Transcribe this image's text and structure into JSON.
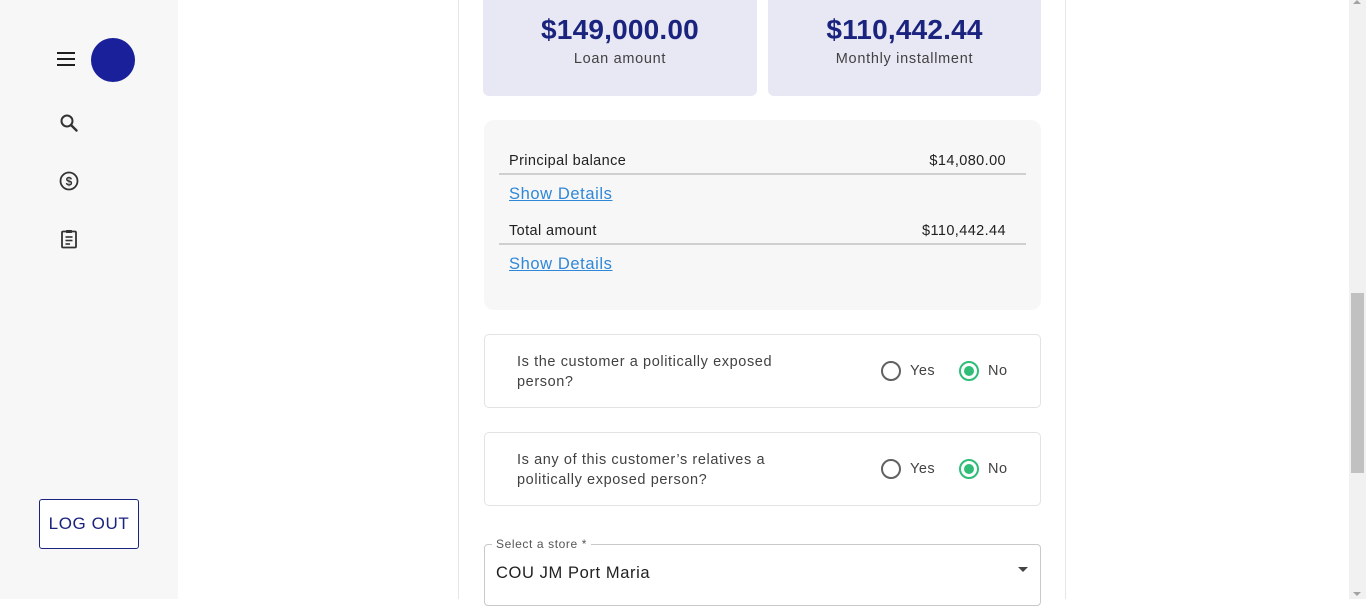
{
  "sidebar": {
    "logout_label": "LOG OUT",
    "icons": [
      "menu-icon",
      "search-icon",
      "dollar-icon",
      "clipboard-icon"
    ]
  },
  "stats": {
    "loan_amount_value": "$149,000.00",
    "loan_amount_label": "Loan amount",
    "monthly_installment_value": "$110,442.44",
    "monthly_installment_label": "Monthly installment"
  },
  "summary": {
    "principal_label": "Principal balance",
    "principal_value": "$14,080.00",
    "total_label": "Total amount",
    "total_value": "$110,442.44",
    "show_details_label": "Show Details"
  },
  "questions": [
    {
      "text": "Is the customer a politically exposed person?",
      "yes_label": "Yes",
      "no_label": "No",
      "selected": "No"
    },
    {
      "text": "Is any of this customer’s relatives a politically exposed person?",
      "yes_label": "Yes",
      "no_label": "No",
      "selected": "No"
    }
  ],
  "store_select": {
    "label": "Select a store *",
    "value": "COU JM Port Maria"
  },
  "colors": {
    "brand": "#1a237e",
    "avatar": "#1a1f9a",
    "stat_card_bg": "#e8e8f5",
    "link": "#2f87d8",
    "radio_selected": "#2fbd78"
  }
}
